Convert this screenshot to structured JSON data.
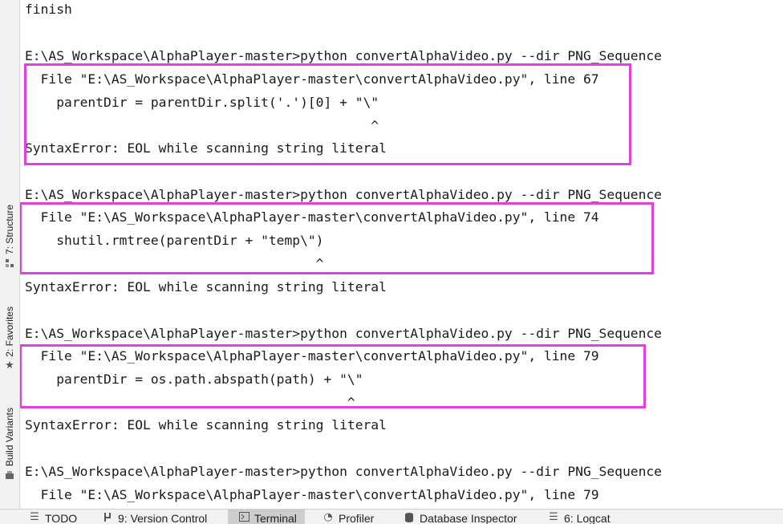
{
  "terminal": {
    "lines": [
      "finish",
      "",
      "E:\\AS_Workspace\\AlphaPlayer-master>python convertAlphaVideo.py --dir PNG_Sequence",
      "  File \"E:\\AS_Workspace\\AlphaPlayer-master\\convertAlphaVideo.py\", line 67",
      "    parentDir = parentDir.split('.')[0] + \"\\\"",
      "                                            ^",
      "SyntaxError: EOL while scanning string literal",
      "",
      "E:\\AS_Workspace\\AlphaPlayer-master>python convertAlphaVideo.py --dir PNG_Sequence",
      "  File \"E:\\AS_Workspace\\AlphaPlayer-master\\convertAlphaVideo.py\", line 74",
      "    shutil.rmtree(parentDir + \"temp\\\")",
      "                                     ^",
      "SyntaxError: EOL while scanning string literal",
      "",
      "E:\\AS_Workspace\\AlphaPlayer-master>python convertAlphaVideo.py --dir PNG_Sequence",
      "  File \"E:\\AS_Workspace\\AlphaPlayer-master\\convertAlphaVideo.py\", line 79",
      "    parentDir = os.path.abspath(path) + \"\\\"",
      "                                         ^",
      "SyntaxError: EOL while scanning string literal",
      "",
      "E:\\AS_Workspace\\AlphaPlayer-master>python convertAlphaVideo.py --dir PNG_Sequence",
      "  File \"E:\\AS_Workspace\\AlphaPlayer-master\\convertAlphaVideo.py\", line 79"
    ]
  },
  "highlight_color": "#e040e0",
  "side_tabs": {
    "structure": {
      "label": "7: Structure",
      "icon": "structure-icon"
    },
    "favorites": {
      "label": "2: Favorites",
      "icon": "star-icon"
    },
    "build_variants": {
      "label": "Build Variants",
      "icon": "build-variants-icon"
    }
  },
  "bottom_tabs": {
    "todo": {
      "label": "TODO",
      "icon": "list-icon"
    },
    "version_control": {
      "label": "9: Version Control",
      "icon": "branch-icon"
    },
    "terminal": {
      "label": "Terminal",
      "icon": "terminal-icon",
      "active": true
    },
    "profiler": {
      "label": "Profiler",
      "icon": "gauge-icon"
    },
    "database_inspector": {
      "label": "Database Inspector",
      "icon": "database-icon"
    },
    "logcat": {
      "label": "6: Logcat",
      "icon": "logcat-icon"
    }
  }
}
